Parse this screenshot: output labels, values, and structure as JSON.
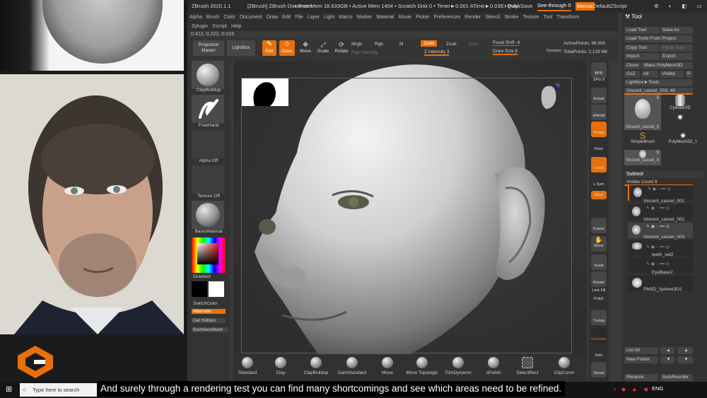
{
  "title_bar": {
    "app": "ZBrush 2020.1.1",
    "doc": "[ZBrush] ZBrush Document",
    "stats": "• Free Mem 18.633GB • Active Mem 1404 • Scratch Disk 0 • Timer►0.001 ATime►0.016 • Poly",
    "ac": "AC",
    "quicksave": "QuickSave",
    "see_through": "See-through  0",
    "menus": "Menus",
    "default_zscript": "DefaultZScript"
  },
  "menu": [
    "Alpha",
    "Brush",
    "Color",
    "Document",
    "Draw",
    "Edit",
    "File",
    "Layer",
    "Light",
    "Macro",
    "Marker",
    "Material",
    "Movie",
    "Picker",
    "Preferences",
    "Render",
    "Stencil",
    "Stroke",
    "Texture",
    "Tool",
    "Transform"
  ],
  "submenu": [
    "Zplugin",
    "Zscript",
    "Help"
  ],
  "coords": "0.412,-0.222,-0.016",
  "top_shelf": {
    "projection_master": "Projection Master",
    "lightbox": "LightBox",
    "edit": "Edit",
    "draw": "Draw",
    "move": "Move",
    "scale": "Scale",
    "rotate": "Rotate",
    "mrgb": "Mrgb",
    "rgb": "Rgb",
    "m": "M",
    "rgb_intensity": "Rgb Intensity",
    "zadd": "Zadd",
    "zsub": "Zsub",
    "zcut": "Zcut",
    "z_intensity": "Z Intensity 3",
    "focal_shift": "Focal Shift -4",
    "draw_size": "Draw Size 8",
    "dynamic": "Dynamic",
    "active_points": "ActivePoints: 96,900",
    "total_points": "TotalPoints: 2.128 Mil"
  },
  "left_shelf": {
    "brush": "ClayBuildup",
    "stroke": "FreeHand",
    "alpha": "Alpha Off",
    "texture": "Texture Off",
    "material": "BasicMaterial",
    "gradient": "Gradient",
    "switch_color": "SwitchColor",
    "alternate": "Alternate",
    "del_hidden": "Del Hidden",
    "backface_mask": "BackfaceMask"
  },
  "right_shelf": [
    "BPR",
    "SPix 3",
    "Actual",
    "AAHalf",
    "Persp",
    "Floor",
    "Local",
    "L.Sym",
    "Gxyz",
    "Frame",
    "Move",
    "Scale",
    "Rotate",
    "Line Fill",
    "PolyF",
    "Transp",
    "Dynamic",
    "Solo",
    "Xpose"
  ],
  "bottom_brushes": [
    "Standard",
    "Clay",
    "ClayBuildup",
    "DamStandard",
    "Move",
    "Move Topologic",
    "TrimDynamic",
    "sPolish",
    "SelectRect",
    "ClipCurve"
  ],
  "tool_palette": {
    "title": "Tool",
    "load_tool": "Load Tool",
    "save_as": "Save As",
    "load_tools_from_project": "Load Tools From Project",
    "copy_tool": "Copy Tool",
    "paste_tool": "Paste Tool",
    "import": "Import",
    "export": "Export",
    "clone": "Clone",
    "make_polymesh": "Make PolyMesh3D",
    "goz": "GoZ",
    "all": "All",
    "visible": "Visible",
    "r": "R",
    "lightbox_tools": "Lightbox►Tools",
    "current_tool": "Vincent_cassel_003. 49",
    "thumbs": [
      {
        "name": "Vincent_cassel_0",
        "count": "6"
      },
      {
        "name": "Cylinder3D",
        "count": ""
      },
      {
        "name": "SimpleBrush",
        "count": ""
      },
      {
        "name": "PolyMesh3D",
        "count": ""
      },
      {
        "name": "PolyMesh3D_1",
        "count": ""
      },
      {
        "name": "Vincent_cassel_0",
        "count": "6"
      }
    ],
    "subtool": "Subtool",
    "visible_count": "Visible Count 9",
    "subtools": [
      "Vincent_cassel_001",
      "Vincent_cassel_002",
      "Vincent_cassel_003",
      "teeth_set2",
      "EyeBase2",
      "PM3D_Sphere3D1"
    ],
    "list_all": "List All",
    "new_folder": "New Folder",
    "rename": "Rename",
    "auto_reorder": "AutoReorder"
  },
  "taskbar": {
    "search_placeholder": "Type here to search",
    "lang": "ENG"
  },
  "subtitle": "And surely through a rendering test you can find many shortcomings and see which areas need to be refined.",
  "colors": {
    "accent": "#e8700a",
    "panel": "#3a3a3a",
    "dark": "#1b1b1b"
  }
}
